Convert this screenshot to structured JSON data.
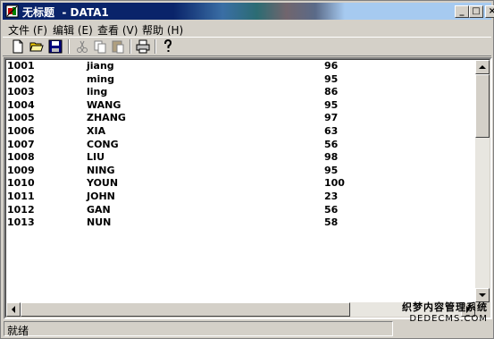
{
  "window": {
    "title": "无标题  - DATA1",
    "controls": {
      "minimize": "_",
      "maximize": "□",
      "close": "×"
    }
  },
  "menu": [
    {
      "label": "文件 (F)"
    },
    {
      "label": "编辑 (E)"
    },
    {
      "label": "查看 (V)"
    },
    {
      "label": "帮助 (H)"
    }
  ],
  "toolbar": {
    "icons": [
      "new-file-icon",
      "open-folder-icon",
      "save-icon",
      "cut-icon",
      "copy-icon",
      "paste-icon",
      "print-icon",
      "help-icon"
    ]
  },
  "table": {
    "rows": [
      {
        "id": "1001",
        "name": "jiang",
        "score": "96"
      },
      {
        "id": "1002",
        "name": "ming",
        "score": "95"
      },
      {
        "id": "1003",
        "name": "ling",
        "score": "86"
      },
      {
        "id": "1004",
        "name": "WANG",
        "score": "95"
      },
      {
        "id": "1005",
        "name": "ZHANG",
        "score": "97"
      },
      {
        "id": "1006",
        "name": "XIA",
        "score": "63"
      },
      {
        "id": "1007",
        "name": "CONG",
        "score": "56"
      },
      {
        "id": "1008",
        "name": "LIU",
        "score": "98"
      },
      {
        "id": "1009",
        "name": "NING",
        "score": "95"
      },
      {
        "id": "1010",
        "name": "YOUN",
        "score": "100"
      },
      {
        "id": "1011",
        "name": "JOHN",
        "score": "23"
      },
      {
        "id": "1012",
        "name": "GAN",
        "score": "56"
      },
      {
        "id": "1013",
        "name": "NUN",
        "score": "58"
      }
    ]
  },
  "status": {
    "text": "就绪"
  },
  "watermark": {
    "line1": "织梦内容管理系统",
    "line2": "DEDECMS.COM"
  },
  "colors": {
    "titlebar_active": "#0a246a",
    "face": "#d4d0c8",
    "window_bg": "#ffffff"
  }
}
